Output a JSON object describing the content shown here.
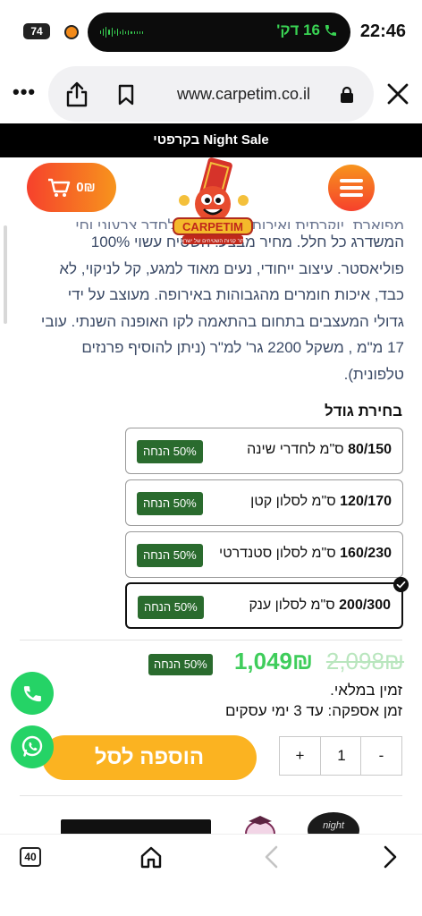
{
  "status": {
    "battery": "74",
    "call_duration": "16 דק'",
    "time": "22:46"
  },
  "browser": {
    "url": "www.carpetim.co.il",
    "more_label": "•••",
    "tabs_count": "40"
  },
  "announcement": "Night Sale בקרפטי",
  "header": {
    "cart_label": "0₪",
    "logo_text": "CARPETIM",
    "logo_tagline": "אתר קניות השטיחים של ישראל"
  },
  "description": {
    "cut_line": "מפוארת, יוקרתית ואיכותית ואת מתן לחדר צבעוני וחי,",
    "lines": [
      "המשדרג כל חלל. מחיר מבצע! השטיח עשוי 100%",
      "פוליאסטר. עיצוב ייחודי, נעים מאוד למגע, קל לניקוי, לא",
      "כבד, איכות חומרים מהגבוהות באירופה. מעוצב על ידי",
      "גדולי המעצבים בתחום בהתאמה לקו האופנה השנתי. עובי",
      "17 מ\"מ , משקל 2200 גר' למ\"ר (ניתן להוסיף פרנזים",
      "טלפונית)."
    ]
  },
  "size_title": "בחירת גודל",
  "size_options": [
    {
      "size": "80/150",
      "suffix": "ס\"מ לחדרי שינה",
      "badge": "50% הנחה",
      "selected": false
    },
    {
      "size": "120/170",
      "suffix": "ס\"מ לסלון קטן",
      "badge": "50% הנחה",
      "selected": false
    },
    {
      "size": "160/230",
      "suffix": "ס\"מ לסלון סטנדרטי",
      "badge": "50% הנחה",
      "selected": false
    },
    {
      "size": "200/300",
      "suffix": "ס\"מ לסלון ענק",
      "badge": "50% הנחה",
      "selected": true
    }
  ],
  "price": {
    "old": "2,098₪",
    "new": "1,049₪",
    "badge": "50% הנחה"
  },
  "availability": "זמין במלאי.",
  "delivery": "זמן אספקה: עד 3 ימי עסקים",
  "quantity": {
    "minus": "-",
    "value": "1",
    "plus": "+"
  },
  "add_to_cart": "הוספה לסל",
  "brand_strip": {
    "night_label": "night"
  },
  "colors": {
    "accent_orange": "#f7941d",
    "accent_red": "#f6412c",
    "discount_green": "#2a6b2e",
    "price_green": "#3fcd5b",
    "cta_yellow": "#fbb321",
    "whatsapp_green": "#25d366"
  }
}
